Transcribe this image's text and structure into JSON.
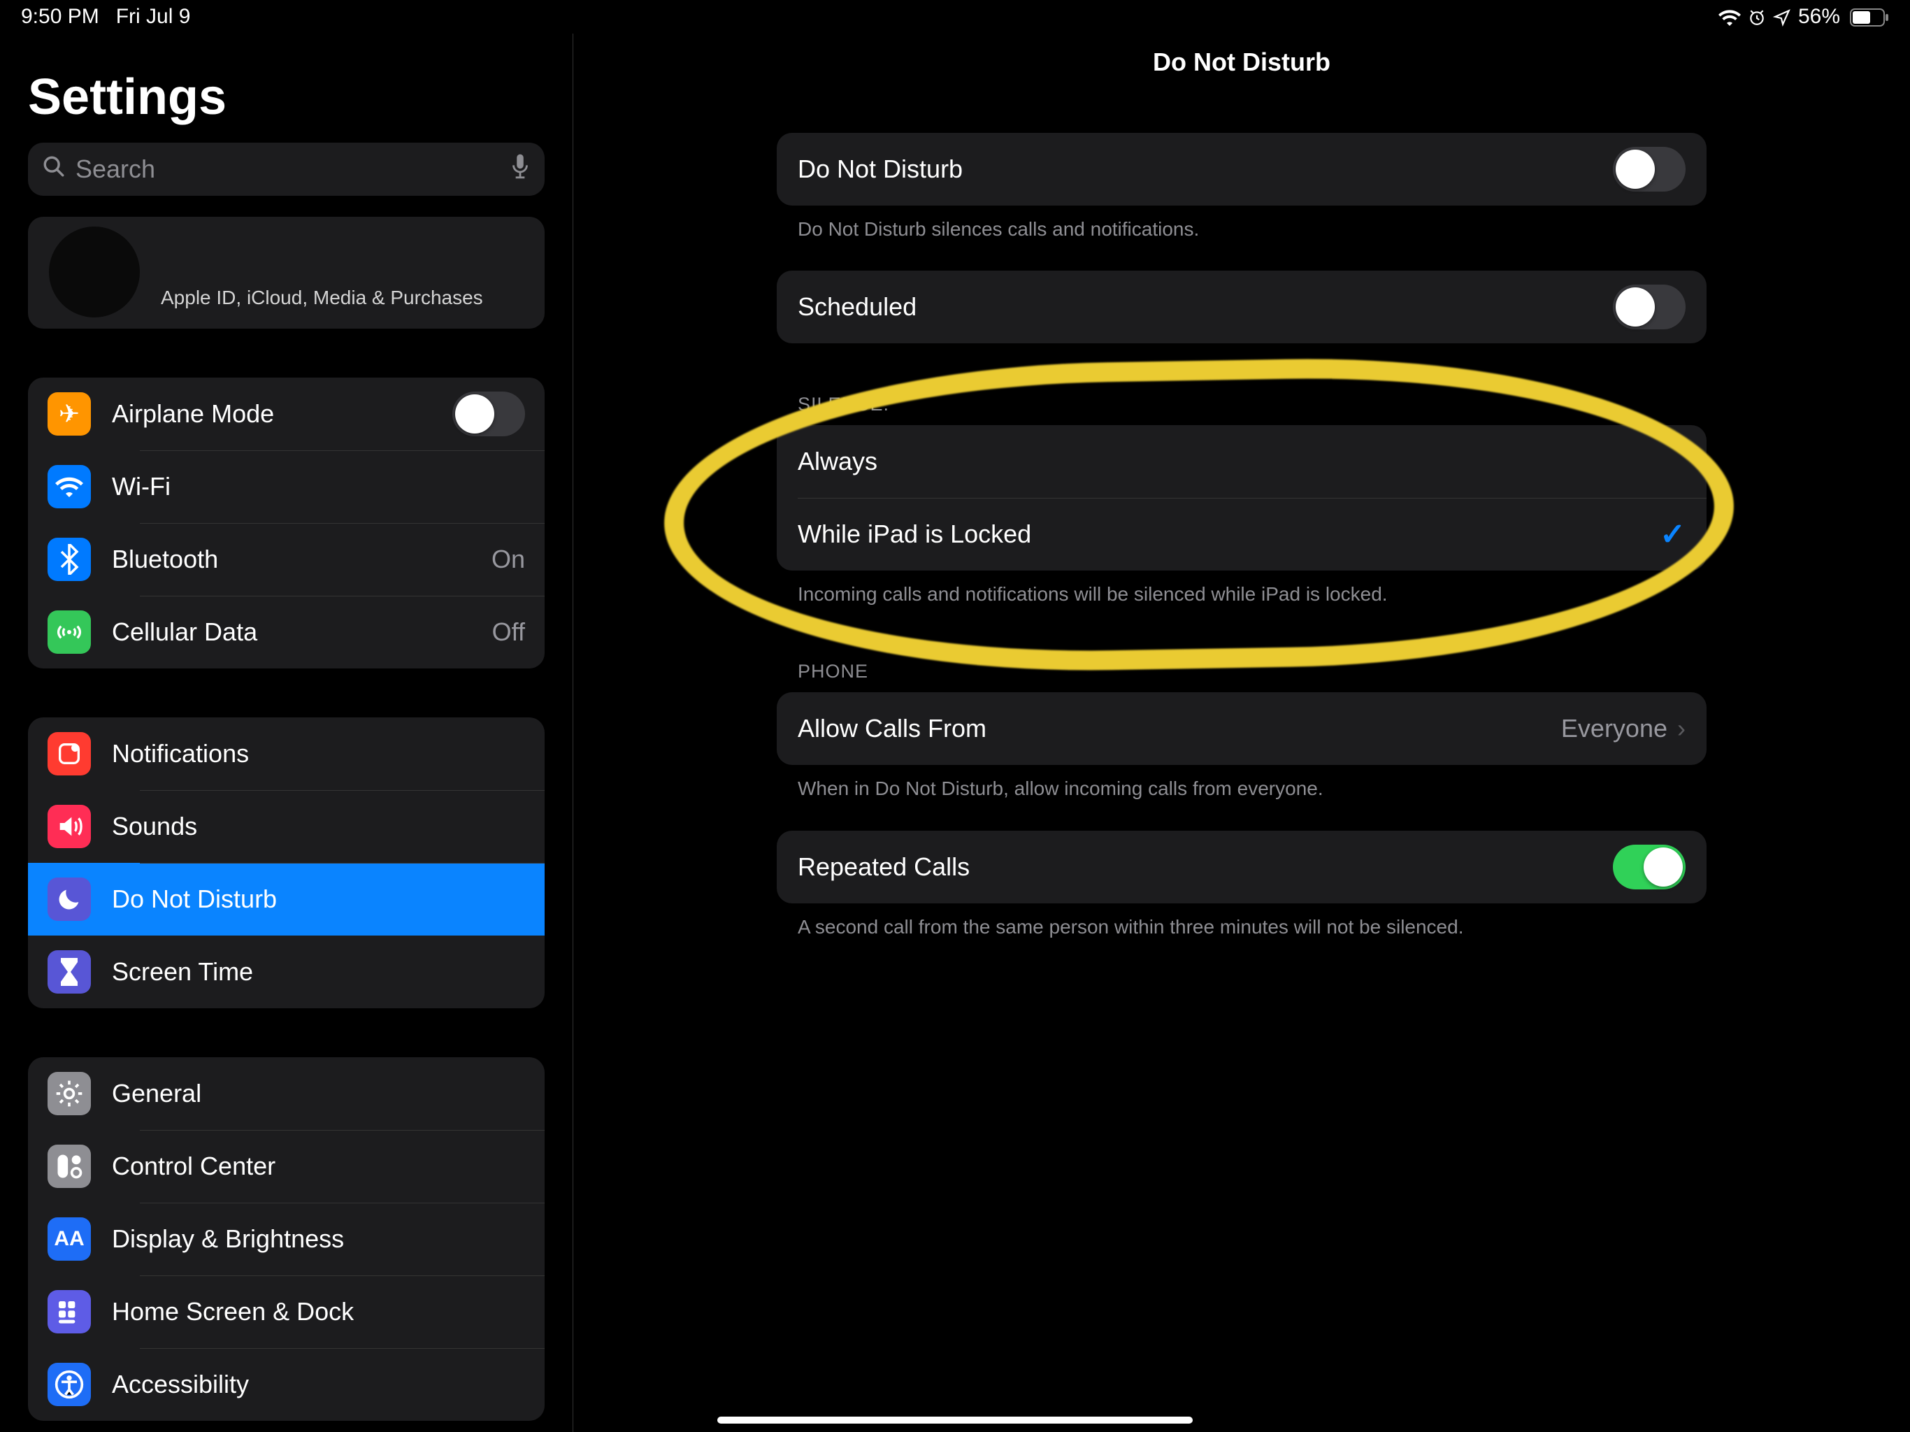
{
  "status": {
    "time": "9:50 PM",
    "date": "Fri Jul 9",
    "battery": "56%"
  },
  "page_title": "Settings",
  "search_placeholder": "Search",
  "apple_id": {
    "subtitle": "Apple ID, iCloud, Media & Purchases"
  },
  "sidebar": {
    "g1": {
      "airplane": {
        "label": "Airplane Mode",
        "on": false
      },
      "wifi": {
        "label": "Wi-Fi",
        "value": ""
      },
      "bluetooth": {
        "label": "Bluetooth",
        "value": "On"
      },
      "cellular": {
        "label": "Cellular Data",
        "value": "Off"
      }
    },
    "g2": {
      "notifications": {
        "label": "Notifications"
      },
      "sounds": {
        "label": "Sounds"
      },
      "dnd": {
        "label": "Do Not Disturb"
      },
      "screentime": {
        "label": "Screen Time"
      }
    },
    "g3": {
      "general": {
        "label": "General"
      },
      "control": {
        "label": "Control Center"
      },
      "display": {
        "label": "Display & Brightness"
      },
      "home": {
        "label": "Home Screen & Dock"
      },
      "accessibility": {
        "label": "Accessibility"
      }
    }
  },
  "detail": {
    "title": "Do Not Disturb",
    "dnd": {
      "label": "Do Not Disturb",
      "on": false,
      "footer": "Do Not Disturb silences calls and notifications."
    },
    "scheduled": {
      "label": "Scheduled",
      "on": false
    },
    "silence": {
      "header": "SILENCE:",
      "always": "Always",
      "locked": "While iPad is Locked",
      "selected": "locked",
      "footer": "Incoming calls and notifications will be silenced while iPad is locked."
    },
    "phone": {
      "header": "PHONE",
      "allow": {
        "label": "Allow Calls From",
        "value": "Everyone"
      },
      "allow_footer": "When in Do Not Disturb, allow incoming calls from everyone.",
      "repeated": {
        "label": "Repeated Calls",
        "on": true
      },
      "repeated_footer": "A second call from the same person within three minutes will not be silenced."
    }
  }
}
